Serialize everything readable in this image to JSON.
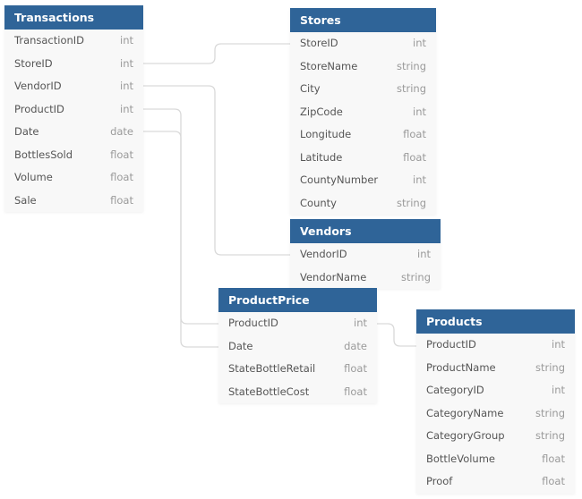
{
  "colors": {
    "header_bg": "#2f6498",
    "header_text": "#ffffff",
    "table_bg": "#f8f8f8",
    "field_text": "#555555",
    "type_text": "#9a9a9a",
    "connector": "#d9d9d9"
  },
  "tables": [
    {
      "id": "transactions",
      "title": "Transactions",
      "fields": [
        {
          "name": "TransactionID",
          "type": "int"
        },
        {
          "name": "StoreID",
          "type": "int"
        },
        {
          "name": "VendorID",
          "type": "int"
        },
        {
          "name": "ProductID",
          "type": "int"
        },
        {
          "name": "Date",
          "type": "date"
        },
        {
          "name": "BottlesSold",
          "type": "float"
        },
        {
          "name": "Volume",
          "type": "float"
        },
        {
          "name": "Sale",
          "type": "float"
        }
      ]
    },
    {
      "id": "stores",
      "title": "Stores",
      "fields": [
        {
          "name": "StoreID",
          "type": "int"
        },
        {
          "name": "StoreName",
          "type": "string"
        },
        {
          "name": "City",
          "type": "string"
        },
        {
          "name": "ZipCode",
          "type": "int"
        },
        {
          "name": "Longitude",
          "type": "float"
        },
        {
          "name": "Latitude",
          "type": "float"
        },
        {
          "name": "CountyNumber",
          "type": "int"
        },
        {
          "name": "County",
          "type": "string"
        }
      ]
    },
    {
      "id": "vendors",
      "title": "Vendors",
      "fields": [
        {
          "name": "VendorID",
          "type": "int"
        },
        {
          "name": "VendorName",
          "type": "string"
        }
      ]
    },
    {
      "id": "productprice",
      "title": "ProductPrice",
      "fields": [
        {
          "name": "ProductID",
          "type": "int"
        },
        {
          "name": "Date",
          "type": "date"
        },
        {
          "name": "StateBottleRetail",
          "type": "float"
        },
        {
          "name": "StateBottleCost",
          "type": "float"
        }
      ]
    },
    {
      "id": "products",
      "title": "Products",
      "fields": [
        {
          "name": "ProductID",
          "type": "int"
        },
        {
          "name": "ProductName",
          "type": "string"
        },
        {
          "name": "CategoryID",
          "type": "int"
        },
        {
          "name": "CategoryName",
          "type": "string"
        },
        {
          "name": "CategoryGroup",
          "type": "string"
        },
        {
          "name": "BottleVolume",
          "type": "float"
        },
        {
          "name": "Proof",
          "type": "float"
        }
      ]
    }
  ],
  "relationships": [
    {
      "from": "Transactions.StoreID",
      "to": "Stores.StoreID"
    },
    {
      "from": "Transactions.VendorID",
      "to": "Vendors.VendorID"
    },
    {
      "from": "Transactions.ProductID",
      "to": "ProductPrice.ProductID"
    },
    {
      "from": "Transactions.Date",
      "to": "ProductPrice.Date"
    },
    {
      "from": "ProductPrice.ProductID",
      "to": "Products.ProductID"
    }
  ]
}
